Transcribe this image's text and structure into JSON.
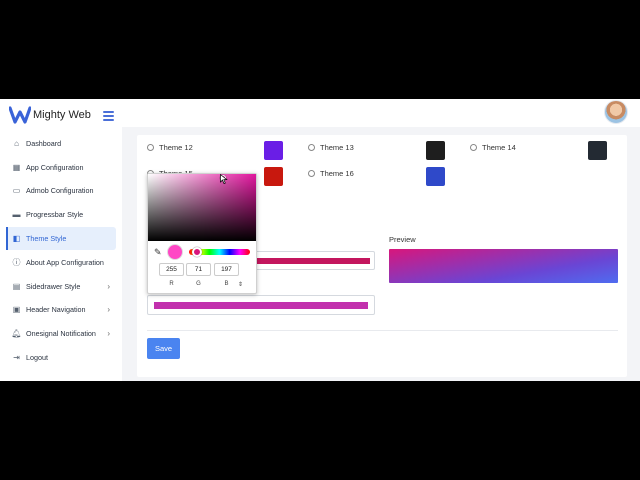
{
  "header": {
    "brand": "Mighty Web"
  },
  "sidebar": {
    "items": [
      {
        "label": "Dashboard"
      },
      {
        "label": "App Configuration"
      },
      {
        "label": "Admob Configuration"
      },
      {
        "label": "Progressbar Style"
      },
      {
        "label": "Theme Style"
      },
      {
        "label": "About App Configuration"
      },
      {
        "label": "Sidedrawer Style"
      },
      {
        "label": "Header Navigation"
      },
      {
        "label": "Onesignal Notification"
      },
      {
        "label": "Logout"
      }
    ]
  },
  "themes": [
    {
      "label": "Theme 12",
      "color": "#6a1ee6"
    },
    {
      "label": "Theme 13",
      "color": "#1e1e1e"
    },
    {
      "label": "Theme 14",
      "color": "#232a33"
    },
    {
      "label": "Theme 15",
      "color": "#c8180e"
    },
    {
      "label": "Theme 16",
      "color": "#2f49c9"
    }
  ],
  "preview": {
    "label": "Preview",
    "gradient_start": "#d8167c",
    "gradient_end": "#4f6cf0"
  },
  "fields": {
    "color1": "#c3165e",
    "color2": "#c230ad"
  },
  "picker": {
    "r": "255",
    "g": "71",
    "b": "197",
    "r_label": "R",
    "g_label": "G",
    "b_label": "B",
    "toggle": "⇕"
  },
  "actions": {
    "save_label": "Save"
  }
}
